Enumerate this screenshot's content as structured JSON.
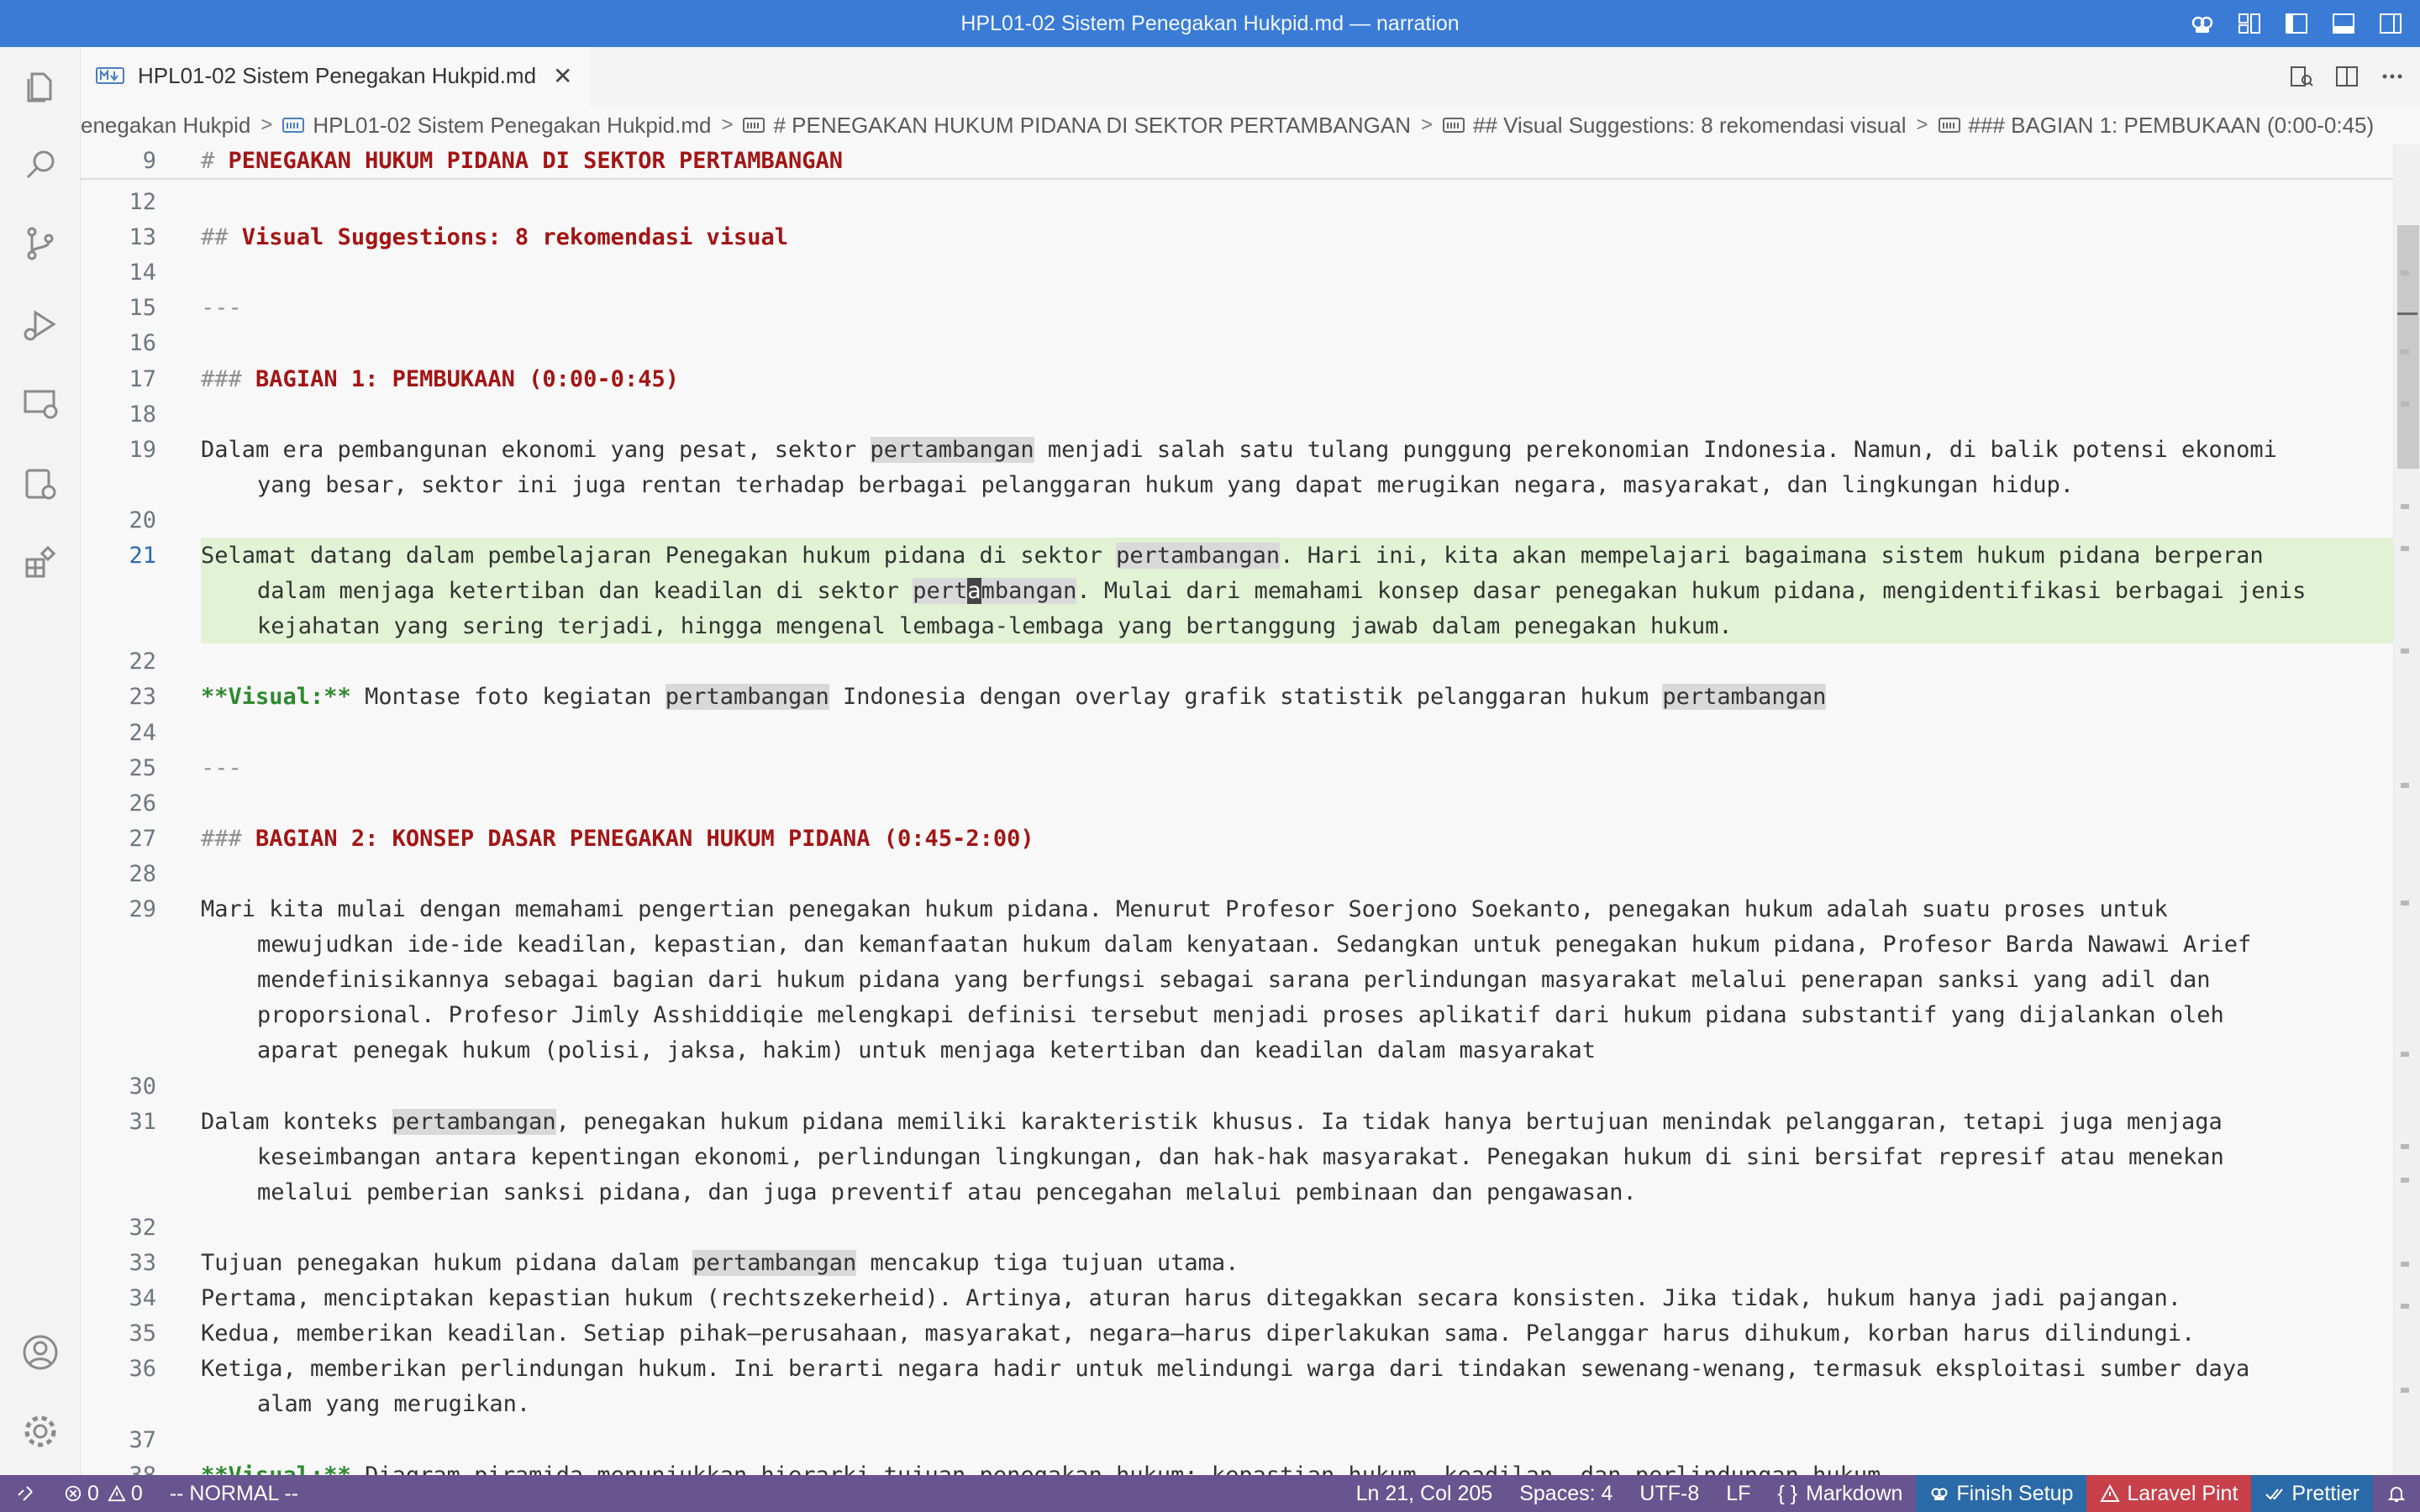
{
  "window": {
    "title": "HPL01-02 Sistem Penegakan Hukpid.md — narration"
  },
  "tab": {
    "label": "HPL01-02 Sistem Penegakan Hukpid.md",
    "close": "✕"
  },
  "breadcrumb": {
    "items": [
      "enegakan Hukpid",
      "HPL01-02 Sistem Penegakan Hukpid.md",
      "# PENEGAKAN HUKUM PIDANA DI SEKTOR PERTAMBANGAN",
      "## Visual Suggestions: 8 rekomendasi visual",
      "### BAGIAN 1: PEMBUKAAN (0:00-0:45)"
    ],
    "separator": ">"
  },
  "editor": {
    "sticky": {
      "line": "9",
      "hash": "#",
      "text": "PENEGAKAN HUKUM PIDANA DI SEKTOR PERTAMBANGAN"
    },
    "lines": [
      {
        "n": "12",
        "segs": []
      },
      {
        "n": "13",
        "segs": [
          [
            "hash",
            "##"
          ],
          [
            "plain",
            " "
          ],
          [
            "heading",
            "Visual Suggestions: 8 rekomendasi visual"
          ]
        ]
      },
      {
        "n": "14",
        "segs": []
      },
      {
        "n": "15",
        "segs": [
          [
            "hash",
            "---"
          ]
        ]
      },
      {
        "n": "16",
        "segs": []
      },
      {
        "n": "17",
        "segs": [
          [
            "hash",
            "###"
          ],
          [
            "plain",
            " "
          ],
          [
            "heading",
            "BAGIAN 1: PEMBUKAAN (0:00-0:45)"
          ]
        ]
      },
      {
        "n": "18",
        "segs": []
      },
      {
        "n": "19",
        "segs": [
          [
            "plain",
            "Dalam era pembangunan ekonomi yang pesat, sektor "
          ],
          [
            "word",
            "pertambangan"
          ],
          [
            "plain",
            " menjadi salah satu tulang punggung perekonomian Indonesia. Namun, di balik potensi ekonomi"
          ]
        ]
      },
      {
        "n": "",
        "indent": true,
        "segs": [
          [
            "plain",
            "yang besar, sektor ini juga rentan terhadap berbagai pelanggaran hukum yang dapat merugikan negara, masyarakat, dan lingkungan hidup."
          ]
        ]
      },
      {
        "n": "20",
        "segs": []
      },
      {
        "n": "21",
        "active": true,
        "segs": [
          [
            "plain",
            "Selamat datang dalam pembelajaran Penegakan hukum pidana di sektor "
          ],
          [
            "word",
            "pertambangan"
          ],
          [
            "plain",
            ". Hari ini, kita akan mempelajari bagaimana sistem hukum pidana berperan"
          ]
        ]
      },
      {
        "n": "",
        "active": true,
        "indent": true,
        "segs": [
          [
            "plain",
            "dalam menjaga ketertiban dan keadilan di sektor "
          ],
          [
            "word",
            "pert"
          ],
          [
            "cursor",
            "a"
          ],
          [
            "word",
            "mbangan"
          ],
          [
            "plain",
            ". Mulai dari memahami konsep dasar penegakan hukum pidana, mengidentifikasi berbagai jenis"
          ]
        ]
      },
      {
        "n": "",
        "active": true,
        "indent": true,
        "segs": [
          [
            "plain",
            "kejahatan yang sering terjadi, hingga mengenal lembaga-lembaga yang bertanggung jawab dalam penegakan hukum."
          ]
        ]
      },
      {
        "n": "22",
        "segs": []
      },
      {
        "n": "23",
        "segs": [
          [
            "green",
            "**Visual:**"
          ],
          [
            "plain",
            " Montase foto kegiatan "
          ],
          [
            "word",
            "pertambangan"
          ],
          [
            "plain",
            " Indonesia dengan overlay grafik statistik pelanggaran hukum "
          ],
          [
            "word",
            "pertambangan"
          ]
        ]
      },
      {
        "n": "24",
        "segs": []
      },
      {
        "n": "25",
        "segs": [
          [
            "hash",
            "---"
          ]
        ]
      },
      {
        "n": "26",
        "segs": []
      },
      {
        "n": "27",
        "segs": [
          [
            "hash",
            "###"
          ],
          [
            "plain",
            " "
          ],
          [
            "heading",
            "BAGIAN 2: KONSEP DASAR PENEGAKAN HUKUM PIDANA (0:45-2:00)"
          ]
        ]
      },
      {
        "n": "28",
        "segs": []
      },
      {
        "n": "29",
        "segs": [
          [
            "plain",
            "Mari kita mulai dengan memahami pengertian penegakan hukum pidana. Menurut Profesor Soerjono Soekanto, penegakan hukum adalah suatu proses untuk"
          ]
        ]
      },
      {
        "n": "",
        "indent": true,
        "segs": [
          [
            "plain",
            "mewujudkan ide-ide keadilan, kepastian, dan kemanfaatan hukum dalam kenyataan. Sedangkan untuk penegakan hukum pidana, Profesor Barda Nawawi Arief"
          ]
        ]
      },
      {
        "n": "",
        "indent": true,
        "segs": [
          [
            "plain",
            "mendefinisikannya sebagai bagian dari hukum pidana yang berfungsi sebagai sarana perlindungan masyarakat melalui penerapan sanksi yang adil dan"
          ]
        ]
      },
      {
        "n": "",
        "indent": true,
        "segs": [
          [
            "plain",
            "proporsional. Profesor Jimly Asshiddiqie melengkapi definisi tersebut menjadi proses aplikatif dari hukum pidana substantif yang dijalankan oleh"
          ]
        ]
      },
      {
        "n": "",
        "indent": true,
        "segs": [
          [
            "plain",
            "aparat penegak hukum (polisi, jaksa, hakim) untuk menjaga ketertiban dan keadilan dalam masyarakat"
          ]
        ]
      },
      {
        "n": "30",
        "segs": []
      },
      {
        "n": "31",
        "segs": [
          [
            "plain",
            "Dalam konteks "
          ],
          [
            "word",
            "pertambangan"
          ],
          [
            "plain",
            ", penegakan hukum pidana memiliki karakteristik khusus. Ia tidak hanya bertujuan menindak pelanggaran, tetapi juga menjaga"
          ]
        ]
      },
      {
        "n": "",
        "indent": true,
        "segs": [
          [
            "plain",
            "keseimbangan antara kepentingan ekonomi, perlindungan lingkungan, dan hak-hak masyarakat. Penegakan hukum di sini bersifat represif atau menekan"
          ]
        ]
      },
      {
        "n": "",
        "indent": true,
        "segs": [
          [
            "plain",
            "melalui pemberian sanksi pidana, dan juga preventif atau pencegahan melalui pembinaan dan pengawasan."
          ]
        ]
      },
      {
        "n": "32",
        "segs": []
      },
      {
        "n": "33",
        "segs": [
          [
            "plain",
            "Tujuan penegakan hukum pidana dalam "
          ],
          [
            "word",
            "pertambangan"
          ],
          [
            "plain",
            " mencakup tiga tujuan utama."
          ]
        ]
      },
      {
        "n": "34",
        "segs": [
          [
            "plain",
            "Pertama, menciptakan kepastian hukum (rechtszekerheid). Artinya, aturan harus ditegakkan secara konsisten. Jika tidak, hukum hanya jadi pajangan."
          ]
        ]
      },
      {
        "n": "35",
        "segs": [
          [
            "plain",
            "Kedua, memberikan keadilan. Setiap pihak—perusahaan, masyarakat, negara—harus diperlakukan sama. Pelanggar harus dihukum, korban harus dilindungi."
          ]
        ]
      },
      {
        "n": "36",
        "segs": [
          [
            "plain",
            "Ketiga, memberikan perlindungan hukum. Ini berarti negara hadir untuk melindungi warga dari tindakan sewenang-wenang, termasuk eksploitasi sumber daya"
          ]
        ]
      },
      {
        "n": "",
        "indent": true,
        "segs": [
          [
            "plain",
            "alam yang merugikan."
          ]
        ]
      },
      {
        "n": "37",
        "segs": []
      },
      {
        "n": "38",
        "segs": [
          [
            "green",
            "**Visual:**"
          ],
          [
            "plain",
            " Diagram piramida menunjukkan hierarki tujuan penegakan hukum: kepastian hukum, keadilan, dan perlindungan hukum"
          ]
        ]
      }
    ]
  },
  "statusbar": {
    "errors": "0",
    "warnings": "0",
    "mode": "-- NORMAL --",
    "position": "Ln 21, Col 205",
    "spaces": "Spaces: 4",
    "encoding": "UTF-8",
    "eol": "LF",
    "language": "Markdown",
    "language_icon": "{ }",
    "finish_setup": "Finish Setup",
    "laravel_pint": "Laravel Pint",
    "prettier": "Prettier"
  },
  "colors": {
    "titlebar": "#3a7bd5",
    "statusbar": "#68558f",
    "heading": "#a31515",
    "visual_label": "#2e8a2e",
    "active_line": "#e2f2d5"
  }
}
